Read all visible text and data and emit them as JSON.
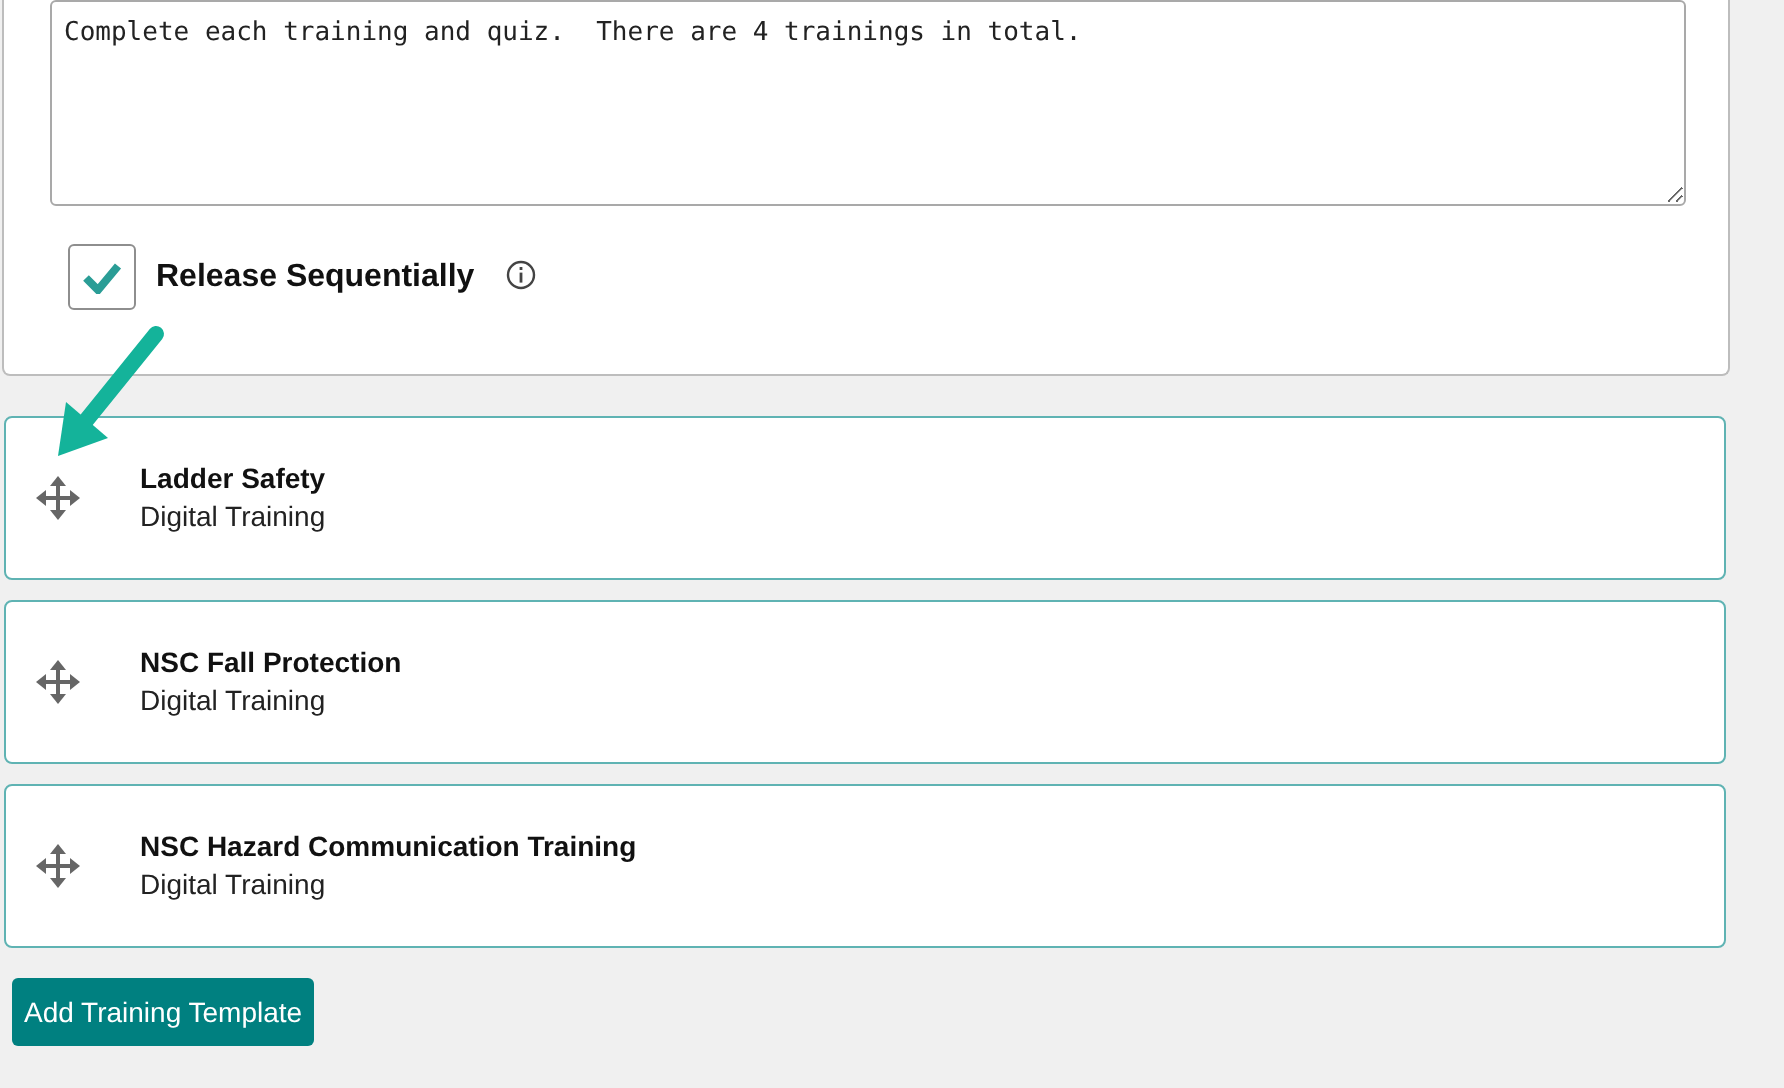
{
  "description": {
    "value": "Complete each training and quiz.  There are 4 trainings in total."
  },
  "release_sequentially": {
    "label": "Release Sequentially",
    "checked": true
  },
  "trainings": [
    {
      "title": "Ladder Safety",
      "type": "Digital Training"
    },
    {
      "title": "NSC Fall Protection",
      "type": "Digital Training"
    },
    {
      "title": "NSC Hazard Communication Training",
      "type": "Digital Training"
    }
  ],
  "add_button": "Add Training Template"
}
